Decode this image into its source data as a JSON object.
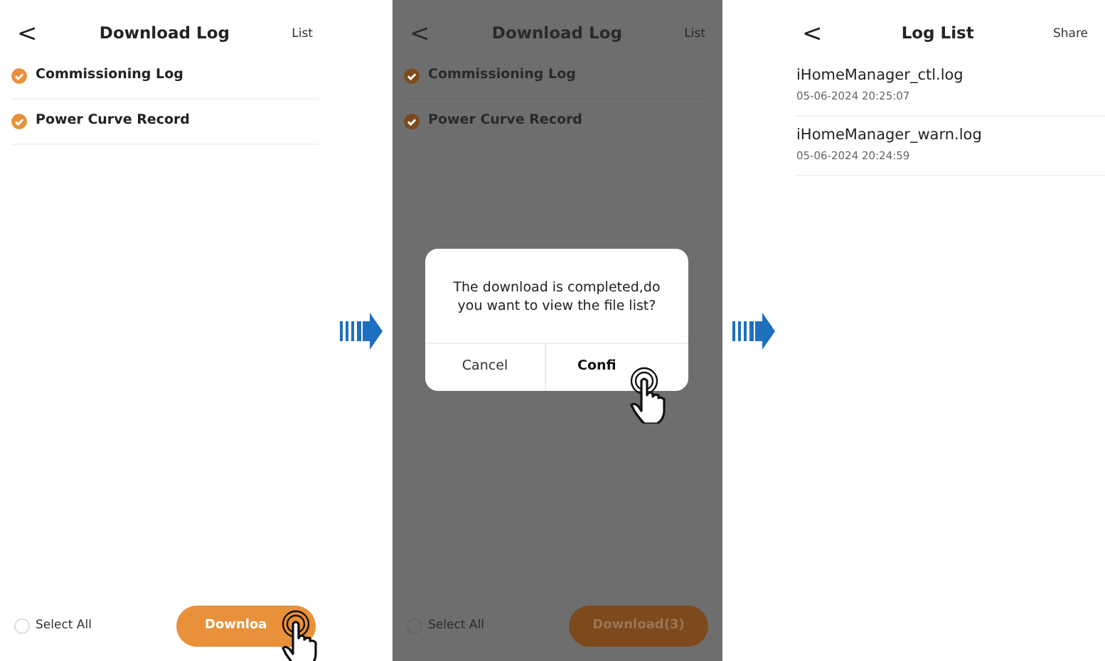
{
  "screens": [
    {
      "kind": "select",
      "dimmed": false,
      "header": {
        "back": "<",
        "title": "Download Log",
        "action": "List"
      },
      "items": [
        {
          "label": "Commissioning Log",
          "checked": true
        },
        {
          "label": "Power Curve Record",
          "checked": true
        }
      ],
      "select_all": {
        "label": "Select All",
        "checked": false
      },
      "download_button": {
        "label": "Downloa",
        "touched": true
      }
    },
    {
      "kind": "select",
      "dimmed": true,
      "header": {
        "back": "<",
        "title": "Download Log",
        "action": "List"
      },
      "items": [
        {
          "label": "Commissioning Log",
          "checked": true
        },
        {
          "label": "Power Curve Record",
          "checked": true
        }
      ],
      "select_all": {
        "label": "Select All",
        "checked": false
      },
      "download_button": {
        "label": "Download(3)",
        "touched": false
      },
      "dialog": {
        "message": "The download is completed,do you want to view the file list?",
        "buttons": [
          {
            "label": "Cancel",
            "primary": false,
            "touched": false
          },
          {
            "label": "Confi",
            "primary": true,
            "touched": true
          }
        ]
      }
    },
    {
      "kind": "files",
      "dimmed": false,
      "header": {
        "back": "<",
        "title": "Log List",
        "action": "Share"
      },
      "files": [
        {
          "name": "iHomeManager_ctl.log",
          "date": "05-06-2024 20:25:07"
        },
        {
          "name": "iHomeManager_warn.log",
          "date": "05-06-2024 20:24:59"
        }
      ]
    }
  ]
}
